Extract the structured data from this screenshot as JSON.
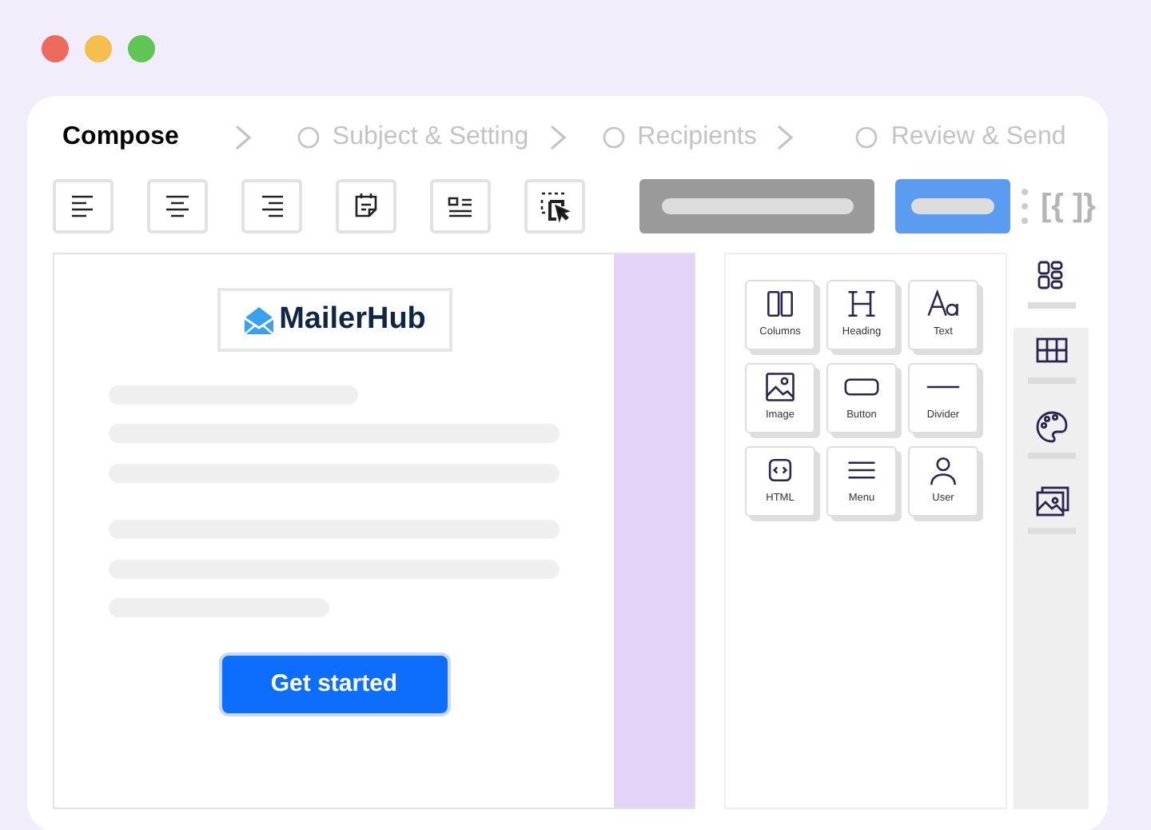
{
  "steps": [
    {
      "label": "Compose",
      "selected": true
    },
    {
      "label": "Subject & Setting",
      "selected": false
    },
    {
      "label": "Recipients",
      "selected": false
    },
    {
      "label": "Review & Send",
      "selected": false
    }
  ],
  "toolbar": {
    "tools": [
      {
        "kind": "align-left"
      },
      {
        "kind": "align-center"
      },
      {
        "kind": "align-right"
      },
      {
        "kind": "note"
      },
      {
        "kind": "layout"
      },
      {
        "kind": "select"
      }
    ],
    "code_label": "[{ ]}"
  },
  "email": {
    "brand": "MailerHub",
    "button": "Get started"
  },
  "blocks": [
    {
      "kind": "columns",
      "label": "Columns"
    },
    {
      "kind": "heading",
      "label": "Heading"
    },
    {
      "kind": "text",
      "label": "Text"
    },
    {
      "kind": "image",
      "label": "Image"
    },
    {
      "kind": "button",
      "label": "Button"
    },
    {
      "kind": "divider",
      "label": "Divider"
    },
    {
      "kind": "html",
      "label": "HTML"
    },
    {
      "kind": "menu",
      "label": "Menu"
    },
    {
      "kind": "user",
      "label": "User"
    }
  ],
  "side_tabs": [
    {
      "kind": "blocks",
      "selected": true
    },
    {
      "kind": "grid",
      "selected": false
    },
    {
      "kind": "palette",
      "selected": false
    },
    {
      "kind": "images",
      "selected": false
    }
  ]
}
